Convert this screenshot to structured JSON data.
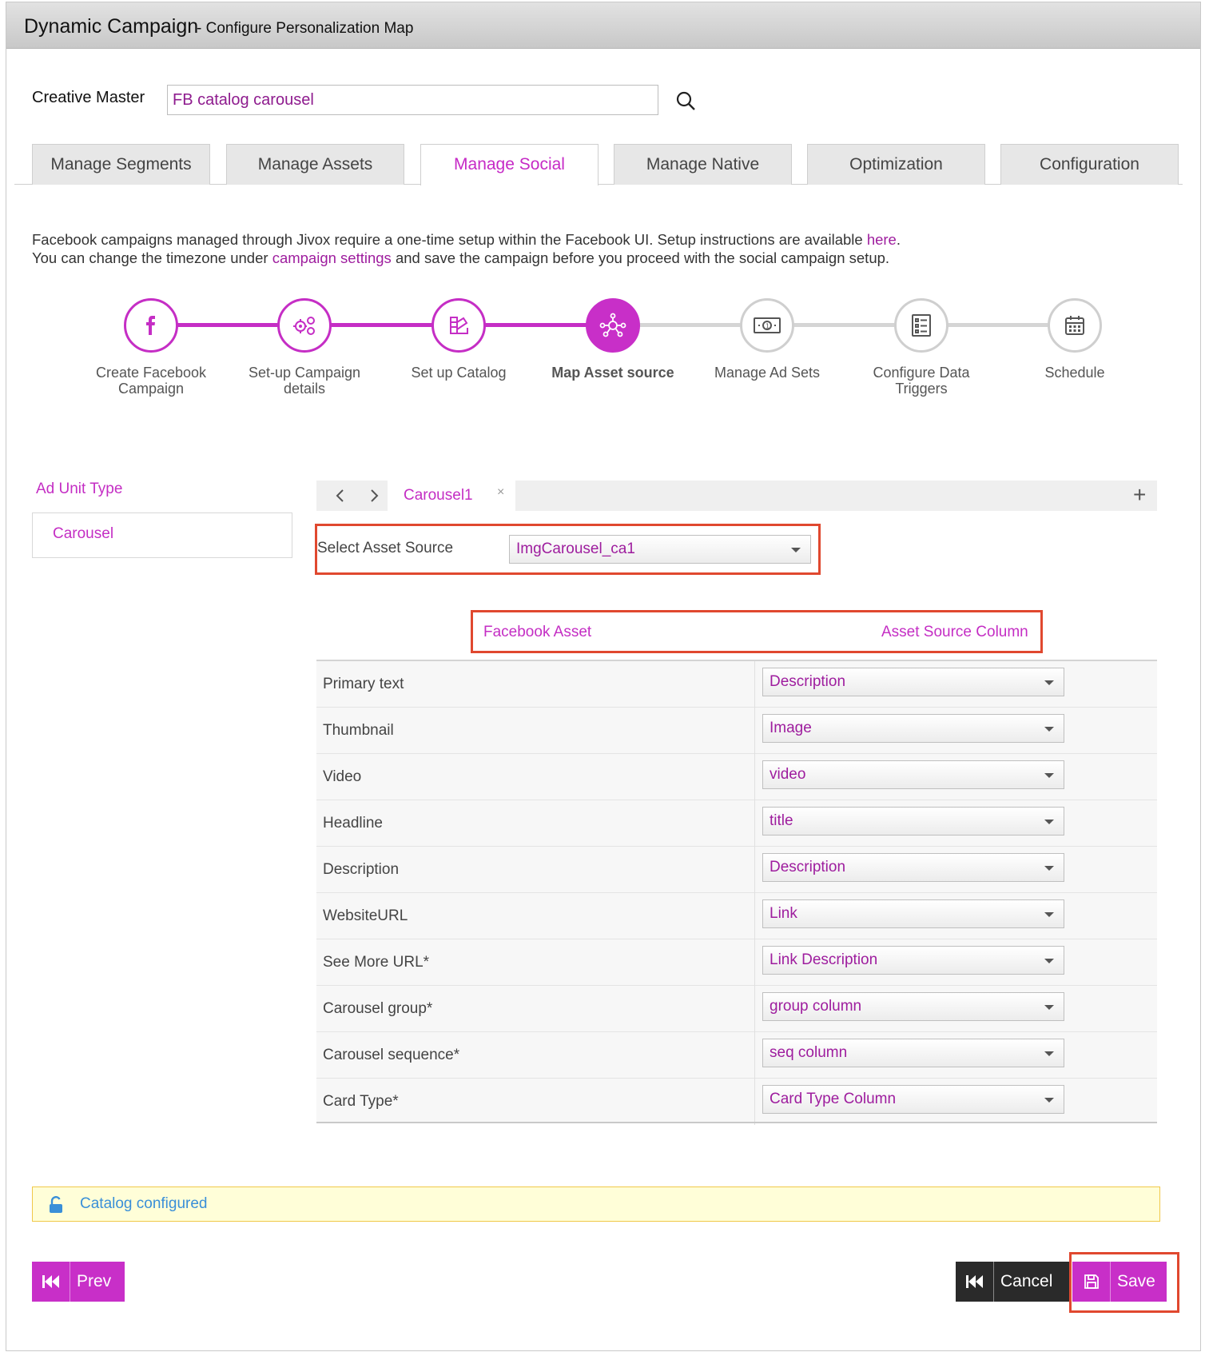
{
  "window": {
    "title": "Dynamic Campaign",
    "subtitle": " - Configure Personalization Map"
  },
  "creative_master": {
    "label": "Creative Master",
    "value": "FB catalog carousel"
  },
  "tabs": [
    {
      "label": "Manage Segments"
    },
    {
      "label": "Manage Assets"
    },
    {
      "label": "Manage Social",
      "active": true
    },
    {
      "label": "Manage Native"
    },
    {
      "label": "Optimization"
    },
    {
      "label": "Configuration"
    }
  ],
  "info": {
    "line1_pre": "Facebook campaigns managed through Jivox require a one-time setup within the Facebook UI. Setup instructions are available ",
    "line1_link": "here",
    "line1_post": ".",
    "line2_pre": "You can change the timezone under ",
    "line2_link": "campaign settings",
    "line2_post": " and save the campaign before you proceed with the social campaign setup."
  },
  "steps": [
    {
      "label": "Create Facebook Campaign",
      "icon": "facebook-icon",
      "state": "done"
    },
    {
      "label": "Set-up Campaign details",
      "icon": "gears-icon",
      "state": "done"
    },
    {
      "label": "Set up Catalog",
      "icon": "catalog-icon",
      "state": "done"
    },
    {
      "label": "Map Asset source",
      "icon": "network-icon",
      "state": "current"
    },
    {
      "label": "Manage Ad Sets",
      "icon": "money-icon",
      "state": "todo"
    },
    {
      "label": "Configure Data Triggers",
      "icon": "checklist-icon",
      "state": "todo"
    },
    {
      "label": "Schedule",
      "icon": "calendar-icon",
      "state": "todo"
    }
  ],
  "ad_unit": {
    "label": "Ad Unit Type",
    "selected": "Carousel"
  },
  "carousel_tab": {
    "label": "Carousel1",
    "close": "×",
    "add": "+"
  },
  "asset_source": {
    "label": "Select Asset Source",
    "value": "ImgCarousel_ca1"
  },
  "mapping": {
    "col1": "Facebook Asset",
    "col2": "Asset Source Column",
    "rows": [
      {
        "asset": "Primary text",
        "column": "Description"
      },
      {
        "asset": "Thumbnail",
        "column": "Image"
      },
      {
        "asset": "Video",
        "column": "video"
      },
      {
        "asset": "Headline",
        "column": "title"
      },
      {
        "asset": "Description",
        "column": "Description"
      },
      {
        "asset": "WebsiteURL",
        "column": "Link"
      },
      {
        "asset": "See More URL*",
        "column": "Link Description"
      },
      {
        "asset": "Carousel group*",
        "column": "group column"
      },
      {
        "asset": "Carousel sequence*",
        "column": "seq column"
      },
      {
        "asset": "Card Type*",
        "column": "Card Type Column"
      }
    ]
  },
  "notice": {
    "text": "Catalog configured",
    "icon": "unlock-icon"
  },
  "buttons": {
    "prev": "Prev",
    "cancel": "Cancel",
    "save": "Save"
  },
  "colors": {
    "accent": "#c82fc8",
    "highlight": "#e0482f",
    "notice_bg": "#fffed8",
    "link": "#3a8fd8"
  }
}
